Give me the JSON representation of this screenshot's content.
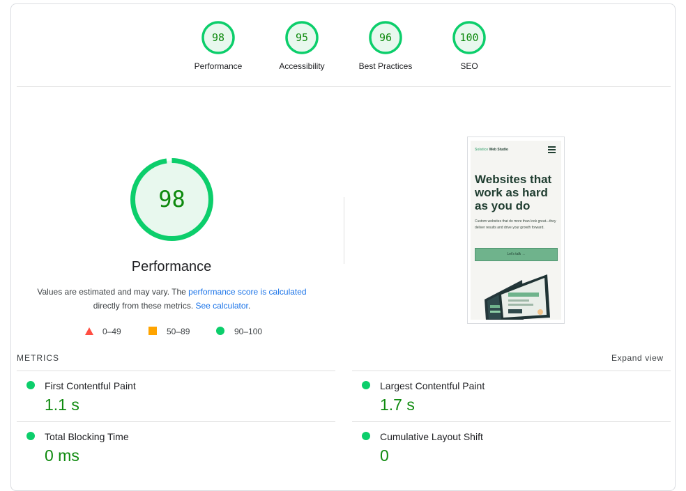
{
  "top_scores": [
    {
      "score": "98",
      "label": "Performance"
    },
    {
      "score": "95",
      "label": "Accessibility"
    },
    {
      "score": "96",
      "label": "Best Practices"
    },
    {
      "score": "100",
      "label": "SEO"
    }
  ],
  "main_gauge": {
    "score": "98",
    "title": "Performance"
  },
  "description": {
    "text1": "Values are estimated and may vary. The ",
    "link1": "performance score is calculated",
    "text2": "directly from these metrics. ",
    "link2": "See calculator",
    "text3": "."
  },
  "legend": [
    {
      "range": "0–49",
      "color": "#ff4e42"
    },
    {
      "range": "50–89",
      "color": "#ffa400"
    },
    {
      "range": "90–100",
      "color": "#0cce6b"
    }
  ],
  "screenshot": {
    "brand_accent": "Solstice",
    "brand_rest": " Web Studio",
    "headline": "Websites that work as hard as you do",
    "body": "Custom websites that do more than look great—they deliver results and drive your growth forward.",
    "cta": "Let's talk  →"
  },
  "metrics_section": {
    "header": "METRICS",
    "expand": "Expand view"
  },
  "metrics": [
    {
      "name": "First Contentful Paint",
      "value": "1.1 s"
    },
    {
      "name": "Largest Contentful Paint",
      "value": "1.7 s"
    },
    {
      "name": "Total Blocking Time",
      "value": "0 ms"
    },
    {
      "name": "Cumulative Layout Shift",
      "value": "0"
    }
  ],
  "colors": {
    "pass": "#0cce6b",
    "pass_text": "#0e8a0e",
    "gauge_fill": "#e8f8ee",
    "link": "#1a73e8"
  }
}
